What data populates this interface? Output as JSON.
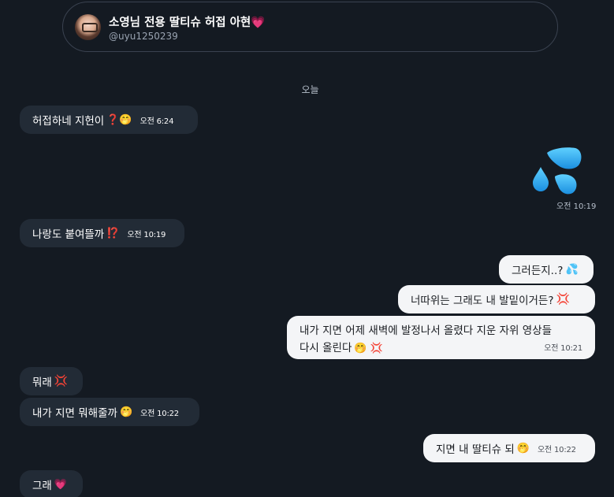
{
  "header": {
    "title": "소영님 전용 딸티슈 허접 아현",
    "title_icon": "💗",
    "handle": "@uyu1250239"
  },
  "date_separator": "오늘",
  "messages": [
    {
      "side": "in",
      "text": "허접하네 지헌이",
      "emoji": "❓🤭",
      "time": "오전 6:24"
    },
    {
      "side": "out",
      "sticker": "💦",
      "time": "오전 10:19"
    },
    {
      "side": "in",
      "text": "나랑도 붙여뜰까",
      "emoji": "⁉️",
      "time": "오전 10:19"
    },
    {
      "side": "out",
      "text": "그러든지..?",
      "emoji": "💦",
      "time": ""
    },
    {
      "side": "out",
      "text": "너따위는 그래도 내 발밑이거든?",
      "emoji": "💢",
      "time": ""
    },
    {
      "side": "out",
      "text_line1": "내가 지면 어제 새벽에 발정나서 올렸다 지운 자위 영상들",
      "text_line2": "다시 올린다",
      "emoji": "🤭 💢",
      "time": "오전 10:21"
    },
    {
      "side": "in",
      "text": "뭐래",
      "emoji": "💢",
      "time": ""
    },
    {
      "side": "in",
      "text": "내가 지면 뭐해줄까",
      "emoji": "🤭",
      "time": "오전 10:22"
    },
    {
      "side": "out",
      "text": "지면 내 딸티슈 되",
      "emoji": "🤭",
      "time": "오전 10:22"
    },
    {
      "side": "in",
      "text": "그래",
      "emoji": "💗",
      "time": ""
    }
  ]
}
